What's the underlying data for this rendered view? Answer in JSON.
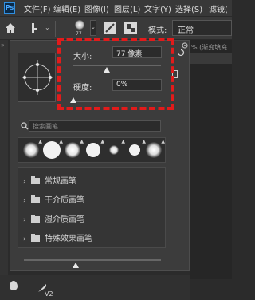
{
  "menubar": {
    "logo": "Ps",
    "items": [
      "文件(F)",
      "编辑(E)",
      "图像(I)",
      "图层(L)",
      "文字(Y)",
      "选择(S)",
      "滤镜("
    ]
  },
  "options_bar": {
    "brush_size_badge": "77",
    "mode_label": "模式:",
    "mode_value": "正常"
  },
  "canvas_tab_hint": "% (渐变填充",
  "brush_panel": {
    "size_label": "大小:",
    "size_value": "77 像素",
    "hardness_label": "硬度:",
    "hardness_value": "0%",
    "size_fraction": 0.38,
    "hardness_fraction": 0.0,
    "search_placeholder": "搜索画笔",
    "groups": [
      "常规画笔",
      "干介质画笔",
      "湿介质画笔",
      "特殊效果画笔"
    ],
    "zoom_fraction": 0.38
  },
  "accent_colors": {
    "highlight": "#e21b1b",
    "ps_blue": "#2f8fe0"
  },
  "bottom_tools": {
    "version_tag": "V2"
  }
}
